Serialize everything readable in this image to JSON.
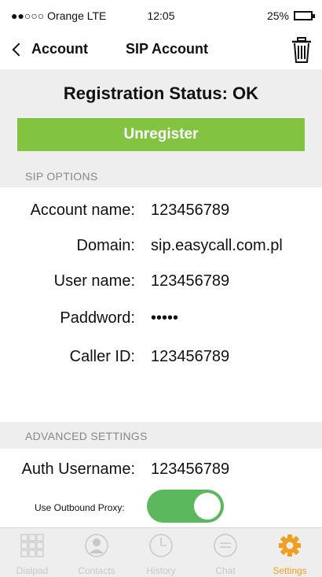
{
  "status_bar": {
    "carrier": "●●○○○ Orange LTE",
    "time": "12:05",
    "battery": "25%",
    "battery_level_pct": 25
  },
  "nav": {
    "back_label": "Account",
    "title": "SIP Account"
  },
  "registration": {
    "status_text": "Registration Status: OK",
    "button_label": "Unregister"
  },
  "sip_options": {
    "header": "SIP OPTIONS",
    "fields": [
      {
        "label": "Account name:",
        "value": "123456789"
      },
      {
        "label": "Domain:",
        "value": "sip.easycall.com.pl"
      },
      {
        "label": "User name:",
        "value": "123456789"
      },
      {
        "label": "Paddword:",
        "value": "•••••"
      },
      {
        "label": "Caller ID:",
        "value": "123456789"
      }
    ]
  },
  "advanced": {
    "header": "ADVANCED SETTINGS",
    "auth_label": "Auth Username:",
    "auth_value": "123456789",
    "proxy_label": "Use Outbound Proxy:",
    "proxy_enabled": true
  },
  "tabs": [
    {
      "label": "Dialpad",
      "icon": "dialpad-icon"
    },
    {
      "label": "Contacts",
      "icon": "contacts-icon"
    },
    {
      "label": "History",
      "icon": "clock-icon"
    },
    {
      "label": "Chat",
      "icon": "chat-icon"
    },
    {
      "label": "Settings",
      "icon": "gear-icon",
      "active": true
    }
  ],
  "colors": {
    "accent_green": "#82c342",
    "toggle_green": "#5cb85c",
    "active_tab": "#f0a020",
    "inactive_tab": "#c8c8c8",
    "band_grey": "#eeeeee"
  }
}
